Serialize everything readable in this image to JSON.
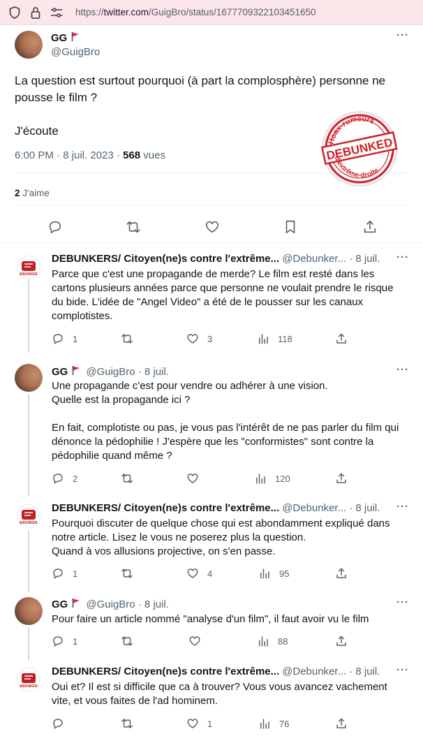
{
  "browser": {
    "url_prefix": "https://",
    "url_host": "twitter.com",
    "url_path": "/GuigBro/status/1677709322103451650"
  },
  "main_tweet": {
    "name": "GG",
    "handle": "@GuigBro",
    "text": "La question est surtout pourquoi (à part la complosphère) personne ne pousse le film ?\n\nJ'écoute",
    "time": "6:00 PM · 8 juil. 2023 · ",
    "views_count": "568",
    "views_label": " vues",
    "likes_count": "2",
    "likes_label": " J'aime",
    "more": "···"
  },
  "stamp": {
    "top_text": "Hoax-rumeurs",
    "center_text": "DEBUNKED",
    "bottom_text": "d'extrême-droite"
  },
  "replies": [
    {
      "name": "DEBUNKERS/ Citoyen(ne)s contre l'extrême...",
      "handle": "@Debunker... · 8 juil.",
      "text": "Parce que c'est une propagande de merde? Le film est resté dans les\ncartons plusieurs années parce que personne ne voulait prendre le risque\ndu bide. L'idée de \"Angel Video\" a été de le pousser sur les canaux\ncomplotistes.",
      "replies_count": "1",
      "retweets_count": "",
      "likes_count": "3",
      "views_count": "118",
      "avatar": "debunkers-logo"
    },
    {
      "name": "GG",
      "handle": "@GuigBro · 8 juil.",
      "text": "Une propagande c'est pour vendre ou adhérer à une vision.\nQuelle est la propagande ici ?\n\nEn fait, complotiste ou pas, je vous pas l'intérêt de ne pas parler du film qui\ndénonce la pédophilie ! J'espère que les \"conformistes\" sont contre la\npédophilie quand même ?",
      "replies_count": "2",
      "retweets_count": "",
      "likes_count": "",
      "views_count": "120",
      "avatar": "gg"
    },
    {
      "name": "DEBUNKERS/ Citoyen(ne)s contre l'extrême...",
      "handle": "@Debunker... · 8 juil.",
      "text": "Pourquoi discuter de quelque chose qui est abondamment expliqué dans\nnotre article. Lisez le vous ne poserez plus la question.\nQuand à vos allusions projective, on s'en passe.",
      "replies_count": "1",
      "retweets_count": "",
      "likes_count": "4",
      "views_count": "95",
      "avatar": "debunkers-logo"
    },
    {
      "name": "GG",
      "handle": "@GuigBro · 8 juil.",
      "text": "Pour faire un article nommé \"analyse d'un film\", il faut avoir vu le film",
      "replies_count": "1",
      "retweets_count": "",
      "likes_count": "",
      "views_count": "88",
      "avatar": "gg"
    },
    {
      "name": "DEBUNKERS/ Citoyen(ne)s contre l'extrême...",
      "handle": "@Debunker... · 8 juil.",
      "text": "Oui et? Il est si difficile que ca à trouver? Vous vous avancez vachement\nvite, et vous faites de l'ad hominem.",
      "replies_count": "",
      "retweets_count": "",
      "likes_count": "1",
      "views_count": "76",
      "avatar": "debunkers-logo"
    }
  ],
  "more": "···",
  "colors": {
    "text": "#0f1419",
    "muted": "#536471",
    "divider": "#eff3f4",
    "flag": "#e0245e",
    "stamp_red": "#d0202a"
  },
  "icons": [
    "shield-icon",
    "lock-icon",
    "site-permissions-icon",
    "reply-icon",
    "retweet-icon",
    "like-icon",
    "bookmark-icon",
    "share-icon",
    "views-icon",
    "more-icon",
    "flag-icon"
  ]
}
